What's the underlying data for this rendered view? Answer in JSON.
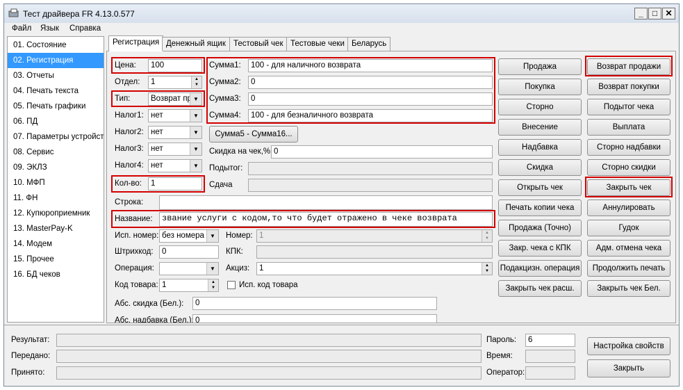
{
  "window": {
    "title": "Тест драйвера FR 4.13.0.577"
  },
  "menu": [
    "Файл",
    "Язык",
    "Справка"
  ],
  "sidebar": {
    "items": [
      "01. Состояние",
      "02. Регистрация",
      "03. Отчеты",
      "04. Печать текста",
      "05. Печать графики",
      "06. ПД",
      "07. Параметры устройства",
      "08. Сервис",
      "09. ЭКЛЗ",
      "10. МФП",
      "11. ФН",
      "12. Купюроприемник",
      "13. MasterPay-K",
      "14. Модем",
      "15. Прочее",
      "16. БД чеков"
    ],
    "selected_index": 1
  },
  "tabs": [
    "Регистрация",
    "Денежный ящик",
    "Тестовый чек",
    "Тестовые чеки",
    "Беларусь"
  ],
  "form": {
    "price_label": "Цена:",
    "price_value": "100",
    "dept_label": "Отдел:",
    "dept_value": "1",
    "type_label": "Тип:",
    "type_value": "Возврат пр",
    "tax1_label": "Налог1:",
    "tax1_value": "нет",
    "tax2_label": "Налог2:",
    "tax2_value": "нет",
    "tax3_label": "Налог3:",
    "tax3_value": "нет",
    "tax4_label": "Налог4:",
    "tax4_value": "нет",
    "qty_label": "Кол-во:",
    "qty_value": "1",
    "sum1_label": "Сумма1:",
    "sum1_value": "100  - для  наличного возврата",
    "sum2_label": "Сумма2:",
    "sum2_value": "0",
    "sum3_label": "Сумма3:",
    "sum3_value": "0",
    "sum4_label": "Сумма4:",
    "sum4_value": "100 - для безналичного возврата",
    "sum5_button": "Сумма5 - Сумма16...",
    "discount_label": "Скидка на чек,%",
    "discount_value": "0",
    "subtotal_label": "Подытог:",
    "subtotal_value": "",
    "change_label": "Сдача",
    "change_value": "",
    "line_label": "Строка:",
    "line_value": "",
    "name_label": "Название:",
    "name_value": "звание услуги с кодом,то что будет отражено в чеке возврата",
    "usenum_label": "Исп. номер:",
    "usenum_value": "без номера",
    "number_label": "Номер:",
    "number_value": "1",
    "barcode_label": "Штрихкод:",
    "barcode_value": "0",
    "kpk_label": "КПК:",
    "kpk_value": "",
    "operation_label": "Операция:",
    "operation_value": "",
    "excise_label": "Акциз:",
    "excise_value": "1",
    "goodscode_label": "Код товара:",
    "goodscode_value": "1",
    "use_goodscode_label": "Исп. код товара",
    "abs_discount_label": "Абс. скидка (Бел.):",
    "abs_discount_value": "0",
    "abs_markup_label": "Абс. надбавка (Бел.):",
    "abs_markup_value": "0"
  },
  "buttons_col1": [
    "Продажа",
    "Покупка",
    "Сторно",
    "Внесение",
    "Надбавка",
    "Скидка",
    "Открыть чек",
    "Печать копии чека",
    "Продажа (Точно)",
    "Закр. чека с КПК",
    "Подакцизн. операция",
    "Закрыть чек расш."
  ],
  "buttons_col2": [
    "Возврат продажи",
    "Возврат покупки",
    "Подытог чека",
    "Выплата",
    "Сторно надбавки",
    "Сторно скидки",
    "Закрыть чек",
    "Аннулировать",
    "Гудок",
    "Адм. отмена чека",
    "Продолжить печать",
    "Закрыть чек Бел."
  ],
  "bottom": {
    "result_label": "Результат:",
    "result_value": "",
    "sent_label": "Передано:",
    "sent_value": "",
    "received_label": "Принято:",
    "received_value": "",
    "password_label": "Пароль:",
    "password_value": "6",
    "time_label": "Время:",
    "time_value": "",
    "operator_label": "Оператор:",
    "operator_value": "",
    "settings_button": "Настройка свойств",
    "close_button": "Закрыть"
  },
  "colors": {
    "highlight": "#d40000",
    "selection": "#3399ff",
    "window_bg": "#f0f0f0",
    "titlebar": "#dbe5f1"
  }
}
